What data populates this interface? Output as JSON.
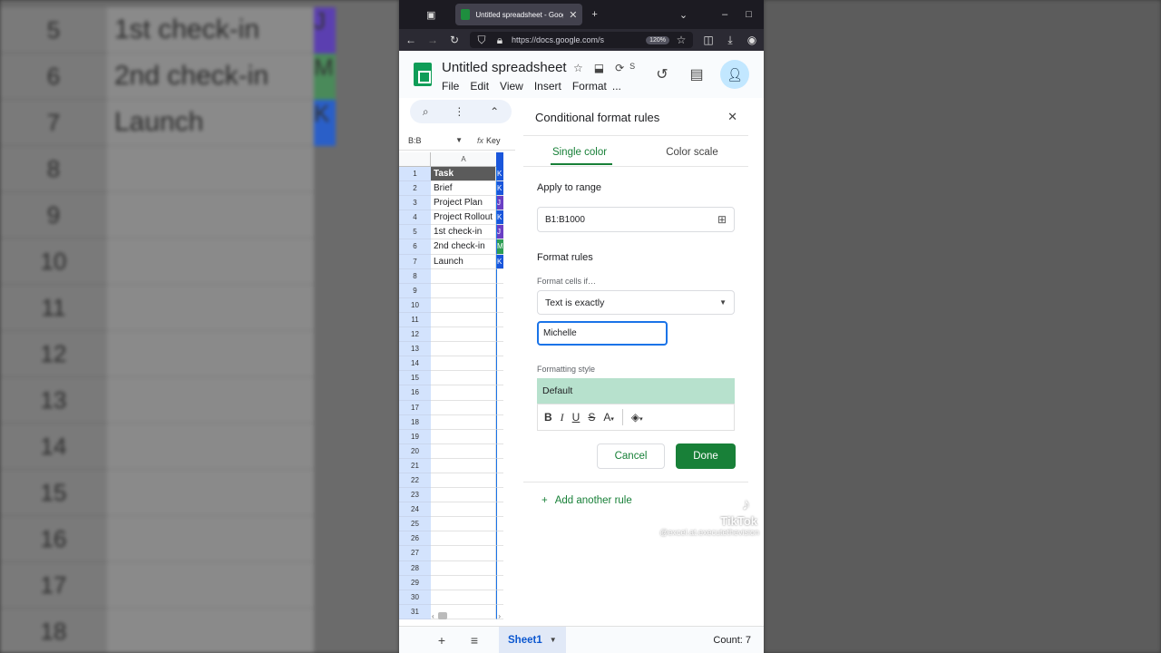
{
  "background": {
    "rows": [
      {
        "num": "5",
        "cell": "1st check-in",
        "strip": "J",
        "strip_color": "#5b3fb0"
      },
      {
        "num": "6",
        "cell": "2nd check-in",
        "strip": "M",
        "strip_color": "#4a8a5a"
      },
      {
        "num": "7",
        "cell": "Launch",
        "strip": "K",
        "strip_color": "#2a5fc8"
      },
      {
        "num": "8",
        "cell": "",
        "strip": "",
        "strip_color": ""
      },
      {
        "num": "9",
        "cell": "",
        "strip": "",
        "strip_color": ""
      },
      {
        "num": "10",
        "cell": "",
        "strip": "",
        "strip_color": ""
      },
      {
        "num": "11",
        "cell": "",
        "strip": "",
        "strip_color": ""
      },
      {
        "num": "12",
        "cell": "",
        "strip": "",
        "strip_color": ""
      },
      {
        "num": "13",
        "cell": "",
        "strip": "",
        "strip_color": ""
      },
      {
        "num": "14",
        "cell": "",
        "strip": "",
        "strip_color": ""
      },
      {
        "num": "15",
        "cell": "",
        "strip": "",
        "strip_color": ""
      },
      {
        "num": "16",
        "cell": "",
        "strip": "",
        "strip_color": ""
      },
      {
        "num": "17",
        "cell": "",
        "strip": "",
        "strip_color": ""
      },
      {
        "num": "18",
        "cell": "",
        "strip": "",
        "strip_color": ""
      }
    ]
  },
  "browser": {
    "tab_title": "Untitled spreadsheet - Google Sheets",
    "url": "https://docs.google.com/s",
    "zoom": "120%"
  },
  "app": {
    "doc_title": "Untitled spreadsheet",
    "menu": [
      "File",
      "Edit",
      "View",
      "Insert",
      "Format",
      "..."
    ],
    "saving_label": "S"
  },
  "grid": {
    "name_box": "B:B",
    "formula_label": "Key",
    "col_a": "A",
    "rows": [
      {
        "n": "1",
        "a": "Task",
        "b": "K",
        "b_color": "#1a56db"
      },
      {
        "n": "2",
        "a": "Brief",
        "b": "K",
        "b_color": "#1a56db"
      },
      {
        "n": "3",
        "a": "Project Plan",
        "b": "J",
        "b_color": "#6a3fc4"
      },
      {
        "n": "4",
        "a": "Project Rollout",
        "b": "K",
        "b_color": "#1a56db"
      },
      {
        "n": "5",
        "a": "1st check-in",
        "b": "J",
        "b_color": "#6a3fc4"
      },
      {
        "n": "6",
        "a": "2nd check-in",
        "b": "M",
        "b_color": "#2e9e55"
      },
      {
        "n": "7",
        "a": "Launch",
        "b": "K",
        "b_color": "#1a56db"
      },
      {
        "n": "8",
        "a": "",
        "b": "",
        "b_color": ""
      },
      {
        "n": "9",
        "a": "",
        "b": "",
        "b_color": ""
      },
      {
        "n": "10",
        "a": "",
        "b": "",
        "b_color": ""
      },
      {
        "n": "11",
        "a": "",
        "b": "",
        "b_color": ""
      },
      {
        "n": "12",
        "a": "",
        "b": "",
        "b_color": ""
      },
      {
        "n": "13",
        "a": "",
        "b": "",
        "b_color": ""
      },
      {
        "n": "14",
        "a": "",
        "b": "",
        "b_color": ""
      },
      {
        "n": "15",
        "a": "",
        "b": "",
        "b_color": ""
      },
      {
        "n": "16",
        "a": "",
        "b": "",
        "b_color": ""
      },
      {
        "n": "17",
        "a": "",
        "b": "",
        "b_color": ""
      },
      {
        "n": "18",
        "a": "",
        "b": "",
        "b_color": ""
      },
      {
        "n": "19",
        "a": "",
        "b": "",
        "b_color": ""
      },
      {
        "n": "20",
        "a": "",
        "b": "",
        "b_color": ""
      },
      {
        "n": "21",
        "a": "",
        "b": "",
        "b_color": ""
      },
      {
        "n": "22",
        "a": "",
        "b": "",
        "b_color": ""
      },
      {
        "n": "23",
        "a": "",
        "b": "",
        "b_color": ""
      },
      {
        "n": "24",
        "a": "",
        "b": "",
        "b_color": ""
      },
      {
        "n": "25",
        "a": "",
        "b": "",
        "b_color": ""
      },
      {
        "n": "26",
        "a": "",
        "b": "",
        "b_color": ""
      },
      {
        "n": "27",
        "a": "",
        "b": "",
        "b_color": ""
      },
      {
        "n": "28",
        "a": "",
        "b": "",
        "b_color": ""
      },
      {
        "n": "29",
        "a": "",
        "b": "",
        "b_color": ""
      },
      {
        "n": "30",
        "a": "",
        "b": "",
        "b_color": ""
      },
      {
        "n": "31",
        "a": "",
        "b": "",
        "b_color": ""
      }
    ]
  },
  "panel": {
    "title": "Conditional format rules",
    "tabs": [
      "Single color",
      "Color scale"
    ],
    "apply_to_range_label": "Apply to range",
    "range_value": "B1:B1000",
    "format_rules_label": "Format rules",
    "format_cells_if_label": "Format cells if…",
    "condition": "Text is exactly",
    "value": "Michelle",
    "formatting_style_label": "Formatting style",
    "style_preview": "Default",
    "style_preview_color": "#b7e1cd",
    "cancel_label": "Cancel",
    "done_label": "Done",
    "add_rule_label": "Add another rule"
  },
  "watermark": {
    "name": "TikTok",
    "handle": "@excel.at.executethevision"
  },
  "bottom": {
    "sheet_name": "Sheet1",
    "count": "Count: 7"
  },
  "colors": {
    "accent_green": "#188038",
    "selection_blue": "#1a73e8"
  }
}
